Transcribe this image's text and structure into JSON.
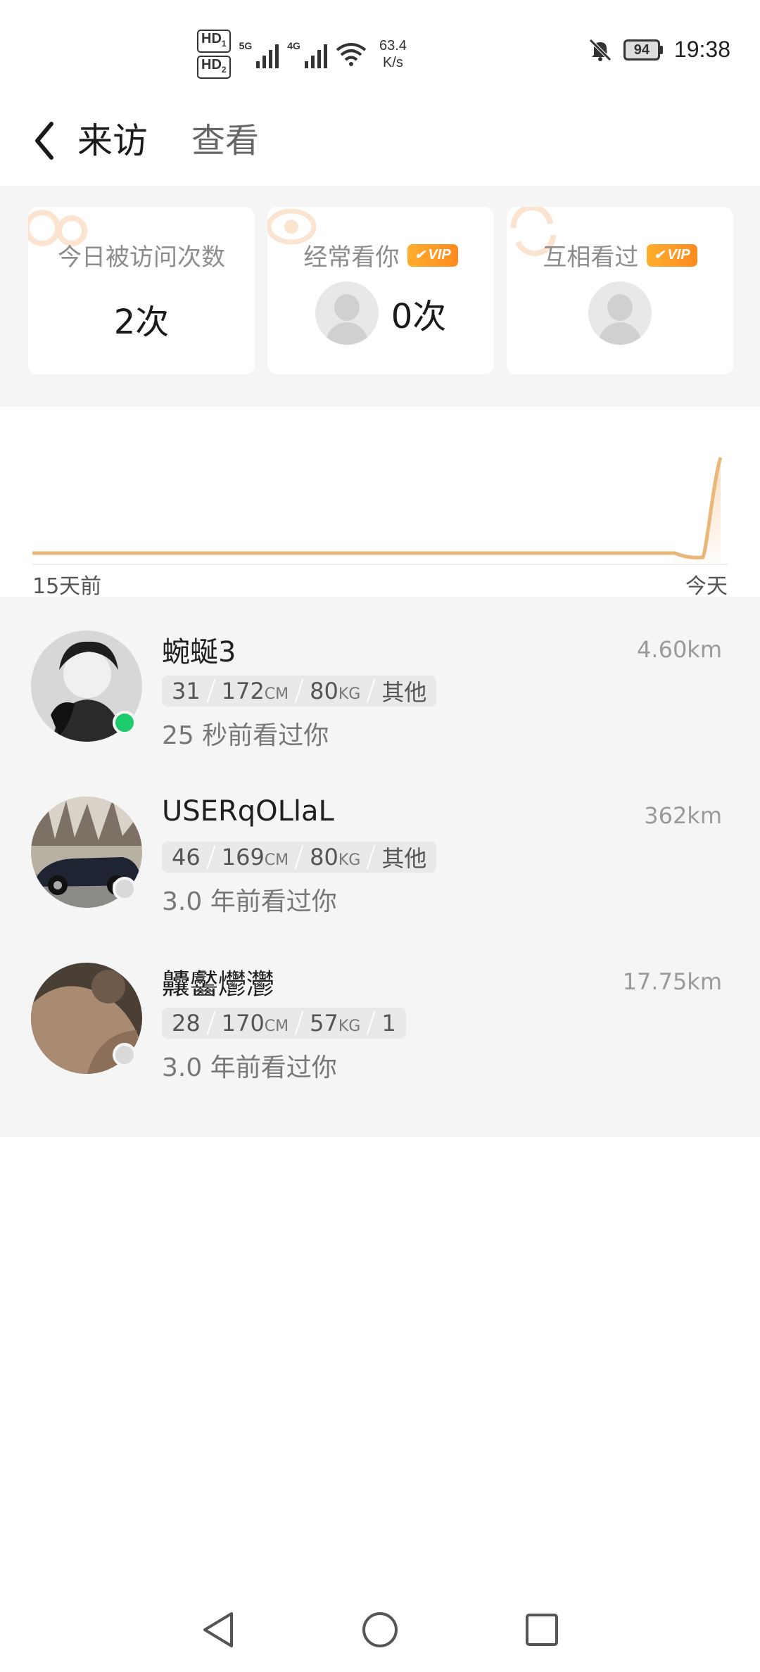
{
  "status_bar": {
    "sim1_label": "HD",
    "sim1_index": "1",
    "sim2_label": "HD",
    "sim2_index": "2",
    "net1": "5G",
    "net2": "4G",
    "speed_value": "63.4",
    "speed_unit": "K/s",
    "battery": "94",
    "time": "19:38"
  },
  "header": {
    "back_icon": "chevron-left-icon",
    "title": "来访",
    "tab": "查看"
  },
  "stats": {
    "today": {
      "label": "今日被访问次数",
      "value": "2次"
    },
    "often": {
      "label": "经常看你",
      "vip": "VIP",
      "value": "0次"
    },
    "mutual": {
      "label": "互相看过",
      "vip": "VIP"
    }
  },
  "chart_data": {
    "type": "line",
    "x": [
      "15天前",
      "",
      "",
      "",
      "",
      "",
      "",
      "",
      "",
      "",
      "",
      "",
      "",
      "",
      "",
      "今天"
    ],
    "values": [
      0,
      0,
      0,
      0,
      0,
      0,
      0,
      0,
      0,
      0,
      0,
      0,
      0,
      0,
      0,
      2
    ],
    "x_start_label": "15天前",
    "x_end_label": "今天",
    "color": "#e9b77a",
    "grid": false,
    "legend": "none"
  },
  "visitors": [
    {
      "name": "蜿蜒3",
      "distance": "4.60km",
      "age": "31",
      "height": "172",
      "height_unit": "CM",
      "weight": "80",
      "weight_unit": "KG",
      "role": "其他",
      "seen": "25 秒前看过你",
      "online": true
    },
    {
      "name": "USERqOLlaL",
      "distance": "362km",
      "age": "46",
      "height": "169",
      "height_unit": "CM",
      "weight": "80",
      "weight_unit": "KG",
      "role": "其他",
      "seen": "3.0 年前看过你",
      "online": false
    },
    {
      "name": "齉齾爩灪",
      "distance": "17.75km",
      "age": "28",
      "height": "170",
      "height_unit": "CM",
      "weight": "57",
      "weight_unit": "KG",
      "role": "1",
      "seen": "3.0 年前看过你",
      "online": false
    }
  ],
  "colors": {
    "online": "#1ecb6b",
    "offline": "#d9d9d9",
    "vip_gradient": [
      "#ffae2e",
      "#ff8a20"
    ],
    "chart_line": "#e9b77a"
  },
  "nav": {
    "back": "triangle-back-icon",
    "home": "circle-home-icon",
    "recents": "square-recents-icon"
  }
}
